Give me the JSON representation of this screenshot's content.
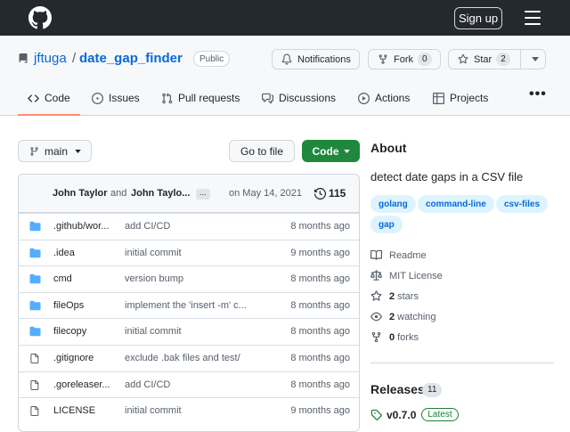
{
  "header": {
    "signin_label": "Sign up"
  },
  "repo": {
    "owner": "jftuga",
    "slash": "/",
    "name": "date_gap_finder",
    "visibility": "Public",
    "notifications_label": "Notifications",
    "fork_label": "Fork",
    "fork_count": "0",
    "star_label": "Star",
    "star_count": "2"
  },
  "tabs": [
    {
      "label": "Code",
      "icon": "code-icon",
      "active": true
    },
    {
      "label": "Issues",
      "icon": "issue-icon"
    },
    {
      "label": "Pull requests",
      "icon": "pull-request-icon"
    },
    {
      "label": "Discussions",
      "icon": "discussion-icon"
    },
    {
      "label": "Actions",
      "icon": "play-icon"
    },
    {
      "label": "Projects",
      "icon": "table-icon"
    },
    {
      "label": "•••",
      "icon": "more-icon"
    }
  ],
  "toolbar": {
    "branch": "main",
    "goto_file": "Go to file",
    "code_button": "Code"
  },
  "commit": {
    "author1": "John Taylor",
    "and": "and",
    "author2": "John Taylo...",
    "ellipsis": "...",
    "date": "on May 14, 2021",
    "history_count": "115"
  },
  "files": [
    {
      "type": "dir",
      "name": ".github/wor...",
      "message": "add CI/CD",
      "age": "8 months ago"
    },
    {
      "type": "dir",
      "name": ".idea",
      "message": "initial commit",
      "age": "9 months ago"
    },
    {
      "type": "dir",
      "name": "cmd",
      "message": "version bump",
      "age": "8 months ago"
    },
    {
      "type": "dir",
      "name": "fileOps",
      "message": "implement the 'insert -m' c...",
      "age": "8 months ago"
    },
    {
      "type": "dir",
      "name": "filecopy",
      "message": "initial commit",
      "age": "8 months ago"
    },
    {
      "type": "file",
      "name": ".gitignore",
      "message": "exclude .bak files and test/",
      "age": "8 months ago"
    },
    {
      "type": "file",
      "name": ".goreleaser...",
      "message": "add CI/CD",
      "age": "8 months ago"
    },
    {
      "type": "file",
      "name": "LICENSE",
      "message": "initial commit",
      "age": "9 months ago"
    }
  ],
  "about": {
    "title": "About",
    "description": "detect date gaps in a CSV file",
    "topics": [
      "golang",
      "command-line",
      "csv-files",
      "gap"
    ],
    "readme": "Readme",
    "license": "MIT License",
    "stars_count": "2",
    "stars_label": "stars",
    "watching_count": "2",
    "watching_label": "watching",
    "forks_count": "0",
    "forks_label": "forks"
  },
  "releases": {
    "title": "Releases",
    "count": "11",
    "latest_version": "v0.7.0",
    "latest_badge": "Latest"
  },
  "colors": {
    "accent_link": "#0969da",
    "primary_button": "#1f883d",
    "active_tab_underline": "#fd8c73",
    "topbar": "#24292f",
    "folder": "#54aeff"
  }
}
